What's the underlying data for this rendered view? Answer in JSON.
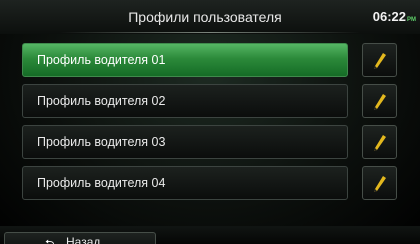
{
  "header": {
    "title": "Профили пользователя",
    "time": "06:22",
    "ampm": "PM"
  },
  "profiles": [
    {
      "label": "Профиль водителя 01",
      "selected": true
    },
    {
      "label": "Профиль водителя 02",
      "selected": false
    },
    {
      "label": "Профиль водителя 03",
      "selected": false
    },
    {
      "label": "Профиль водителя 04",
      "selected": false
    }
  ],
  "footer": {
    "back_label": "Назад",
    "back_icon": "back-arrow-icon"
  },
  "icons": {
    "edit": "pencil-icon"
  },
  "colors": {
    "selected_green": "#2c8a3a",
    "pencil_yellow": "#e3b81e",
    "clock_ampm": "#5fd06a"
  }
}
